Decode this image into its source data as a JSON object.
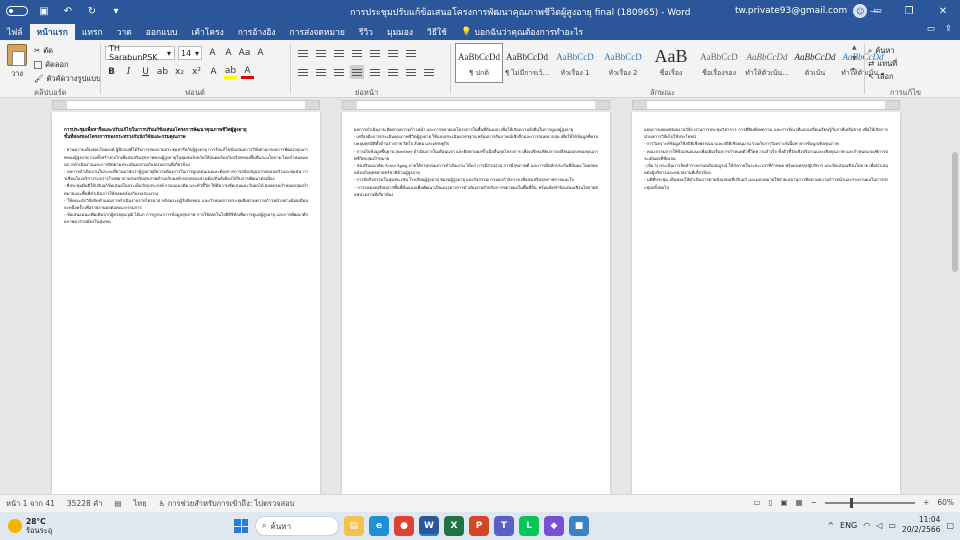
{
  "window": {
    "title": "การประชุมปรับแก้ข้อเสนอโครงการพัฒนาคุณภาพชีวิตผู้สูงอายุ final (180965) - Word",
    "user": "tw.private93@gmail.com",
    "autosave_label": "",
    "controls": [
      "—",
      "❐",
      "✕"
    ]
  },
  "tabs": [
    "ไฟล์",
    "หน้าแรก",
    "แทรก",
    "วาด",
    "ออกแบบ",
    "เค้าโครง",
    "การอ้างอิง",
    "การส่งจดหมาย",
    "รีวิว",
    "มุมมอง",
    "วิธีใช้"
  ],
  "active_tab": "หน้าแรก",
  "tell_me": "บอกฉันว่าคุณต้องการทำอะไร",
  "ribbon": {
    "clipboard": {
      "paste_label": "วาง",
      "items": [
        "ตัด",
        "คัดลอก",
        "ตัวคัดวางรูปแบบ"
      ],
      "group_label": "คลิปบอร์ด"
    },
    "font": {
      "family": "TH SarabunPSK",
      "size": "14",
      "buttons_row1": [
        "A",
        "A",
        "Aa",
        "A"
      ],
      "buttons_row2": [
        "B",
        "I",
        "U",
        "ab",
        "x₂",
        "x²",
        "A",
        "ab",
        "A"
      ],
      "group_label": "ฟอนต์"
    },
    "paragraph": {
      "group_label": "ย่อหน้า"
    },
    "styles": {
      "items": [
        {
          "sample": "AaBbCcDd",
          "name": "¶ ปกติ"
        },
        {
          "sample": "AaBbCcDd",
          "name": "¶ ไม่มีการเว้..."
        },
        {
          "sample": "AaBbCcD",
          "name": "หัวเรื่อง 1"
        },
        {
          "sample": "AaBbCcD",
          "name": "หัวเรื่อง 2"
        },
        {
          "sample": "AaB",
          "name": "ชื่อเรื่อง"
        },
        {
          "sample": "AaBbCcD",
          "name": "ชื่อเรื่องรอง"
        },
        {
          "sample": "AaBbCcDd",
          "name": "ทำให้ตัวเน้น..."
        },
        {
          "sample": "AaBbCcDd",
          "name": "ตัวเน้น"
        },
        {
          "sample": "AaBbCcDd",
          "name": "ทำให้ตัวเน้น..."
        }
      ],
      "group_label": "ลักษณะ"
    },
    "editing": {
      "items": [
        "ค้นหา",
        "แทนที่",
        "เลือก"
      ],
      "group_label": "การแก้ไข"
    }
  },
  "pages": [
    {
      "heading": "การประชุมเพื่อหารือและปรับแก้ไขในการปรับแก้ข้อเสนอโครงการพัฒนาคุณภาพชีวิตผู้สูงอายุ\nขั้นที่สองของโครงการของกระทรวงกับนักวิจัยและกรมคุณภาพ",
      "body": "   - ผ่านความเห็นชอบโดยองค์ ผู้มีเกณฑ์ได้รับการสอบถามประชุมหารือกับผู้สูงอายุ การรับแก้ไขข้อเสนอการวิจัยตามกรอบการพัฒนาคุณภาพของผู้สูงอายุ รวมทั้งสร้างกลไกเพื่อส่งเสริมสุขภาพของผู้สูงอายุในชุมชนจังหวัดให้สอดคล้องกับบริบทของพื้นที่และนโยบาย โดยกำหนดแผนการดำเนินงานและการติดตามประเมินผลร่วมกับหน่วยงานที่เกี่ยวข้อง\n   - ผลการดำเนินงานในระยะที่ผ่านมาพบว่าผู้สูงอายุมีความต้องการในการดูแลตนเองและต้องการการสนับสนุนจากครอบครัวและชุมชน การเชื่อมโยงบริการระหว่างโรงพยาบาลส่งเสริมสุขภาพตำบลกับองค์กรปกครองส่วนท้องถิ่นยังต้องได้รับการพัฒนาต่อเนื่อง\n   - ที่ประชุมมีมติให้ปรับแก้ข้อเสนอในประเด็นวัตถุประสงค์ กรอบแนวคิด และตัวชี้วัด ให้มีความชัดเจนและวัดผลได้ ตลอดจนกำหนดกลุ่มเป้าหมายและพื้นที่ดำเนินการให้สอดคล้องกับงบประมาณ\n   - ให้คณะนักวิจัยจัดทำแผนการดำเนินงานรายไตรมาส พร้อมระบุผู้รับผิดชอบ และกำหนดการประชุมติดตามความก้าวหน้าอย่างน้อยเดือนละหนึ่งครั้ง เพื่อรายงานผลต่อคณะกรรมการ\n   - ข้อเสนอแนะเพิ่มเติมจากผู้ทรงคุณวุฒิ ได้แก่ การบูรณาการข้อมูลสุขภาพ การใช้เทคโนโลยีดิจิทัลเพื่อการดูแลผู้สูงอายุ และการพัฒนาศักยภาพอาสาสมัครในชุมชน"
    },
    {
      "heading": "",
      "body": "ผลการดำเนินงาน ติดตามความก้าวหน้า และการขยายผลโครงการในพื้นที่ต้นแบบ เพื่อให้เกิดความยั่งยืนในการดูแลผู้สูงอายุ\n   - เครื่องมือการประเมินคุณภาพชีวิตผู้สูงอายุ ใช้แบบประเมินมาตรฐาน พร้อมการสัมภาษณ์เชิงลึกและการสนทนากลุ่ม เพื่อให้ได้ข้อมูลที่ครอบคลุมทุกมิติทั้งด้านร่างกาย จิตใจ สังคม และเศรษฐกิจ\n   - การเก็บข้อมูลพื้นฐาน (baseline) ดำเนินการในเดือนแรก และติดตามผลซ้ำเมื่อสิ้นสุดโครงการ เพื่อเปรียบเทียบการเปลี่ยนแปลงของคุณภาพชีวิตกลุ่มเป้าหมาย\n   - ส่งเสริมแนวคิด Active Aging ภายใต้กรอบของการดำเนินงาน ได้แก่ การมีส่วนร่วม การมีสุขภาพดี และการมีหลักประกันที่มั่นคง โดยสอดคล้องกับยุทธศาสตร์ชาติด้านผู้สูงอายุ\n   - การจัดกิจกรรมในชุมชน เช่น โรงเรียนผู้สูงอายุ ชมรมผู้สูงอายุ และกิจกรรมการออกกำลังกาย เพื่อส่งเสริมสุขภาพกายและใจ\n   - การถอดบทเรียนจากพื้นที่ต้นแบบเพื่อพัฒนาเป็นแนวทางการดำเนินงานสำหรับการขยายผลในพื้นที่อื่น พร้อมจัดทำข้อเสนอเชิงนโยบายต่อหน่วยงานที่เกี่ยวข้อง"
    },
    {
      "heading": "",
      "body": "แผนการเผยแพร่ผลงานวิจัย ผ่านการประชุมวิชาการ การตีพิมพ์บทความ และการจัดเวทีแลกเปลี่ยนเรียนรู้กับภาคีเครือข่าย เพื่อให้เกิดการนำผลการวิจัยไปใช้ประโยชน์\n   - การวิเคราะห์ข้อมูลใช้สถิติเชิงพรรณนาและสถิติเชิงอนุมาน ร่วมกับการวิเคราะห์เนื้อหาจากข้อมูลเชิงคุณภาพ\n   - คณะกรรมการให้ข้อเสนอแนะเพิ่มเติมเรื่องการกำหนดตัวชี้วัดความสำเร็จ ทั้งตัวชี้วัดเชิงปริมาณและเชิงคุณภาพ และกำหนดเกณฑ์การประเมินผลที่ชัดเจน\n   - (ข้อ 5) ประเด็นการจัดทำรายงานฉบับสมบูรณ์ ให้ส่งภายในระยะเวลาที่กำหนด พร้อมบทสรุปผู้บริหาร และข้อเสนอเชิงนโยบาย เพื่อนำเสนอต่อผู้บริหารและหน่วยงานที่เกี่ยวข้อง\n   - มติที่ประชุม เห็นชอบให้ดำเนินการตามข้อเสนอที่ปรับแก้ และมอบหมายให้ฝ่ายเลขานุการติดตามความก้าวหน้าและรายงานผลในการประชุมครั้งต่อไป"
    }
  ],
  "statusbar": {
    "page": "หน้า 1 จาก 41",
    "words": "35228 คำ",
    "language": "ไทย",
    "accessibility": "การช่วยสำหรับการเข้าถึง: ไปตรวจสอบ",
    "zoom": "60%"
  },
  "taskbar": {
    "temperature": "28°C",
    "weather": "ร้อนระอุ",
    "search_label": "ค้นหา",
    "apps": [
      {
        "name": "file-explorer",
        "color": "#f2c14e",
        "glyph": "▤"
      },
      {
        "name": "edge",
        "color": "#1f8fd6",
        "glyph": "e"
      },
      {
        "name": "chrome",
        "color": "#db4437",
        "glyph": "●"
      },
      {
        "name": "word",
        "color": "#2b579a",
        "glyph": "W",
        "active": true
      },
      {
        "name": "excel",
        "color": "#217346",
        "glyph": "X"
      },
      {
        "name": "powerpoint",
        "color": "#d24726",
        "glyph": "P"
      },
      {
        "name": "teams",
        "color": "#5b5fc7",
        "glyph": "T"
      },
      {
        "name": "line",
        "color": "#06c755",
        "glyph": "L"
      },
      {
        "name": "photos",
        "color": "#7a4fd1",
        "glyph": "◆"
      },
      {
        "name": "store",
        "color": "#3b82c4",
        "glyph": "■"
      }
    ],
    "lang": "ENG",
    "time": "11:04",
    "date": "20/2/2566"
  }
}
